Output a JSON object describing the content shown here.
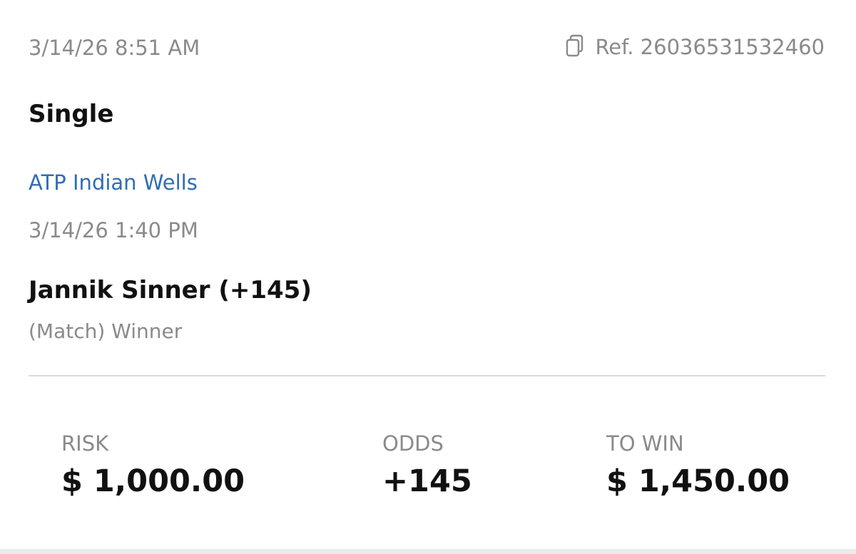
{
  "bet": {
    "placed_time": "3/14/26 8:51 AM",
    "reference": "Ref. 26036531532460",
    "type": "Single",
    "event_name": "ATP Indian Wells",
    "event_time": "3/14/26 1:40 PM",
    "selection": "Jannik Sinner (+145)",
    "market": "(Match) Winner",
    "copy_icon": "copy-icon"
  },
  "summary": {
    "risk_label": "RISK",
    "risk_value": "$ 1,000.00",
    "odds_label": "ODDS",
    "odds_value": "+145",
    "to_win_label": "TO WIN",
    "to_win_value": "$ 1,450.00"
  },
  "colors": {
    "link": "#2f6db6",
    "muted": "#8a8a8a",
    "primary_text": "#111111",
    "divider": "#d9d9d9",
    "background": "#ffffff"
  }
}
